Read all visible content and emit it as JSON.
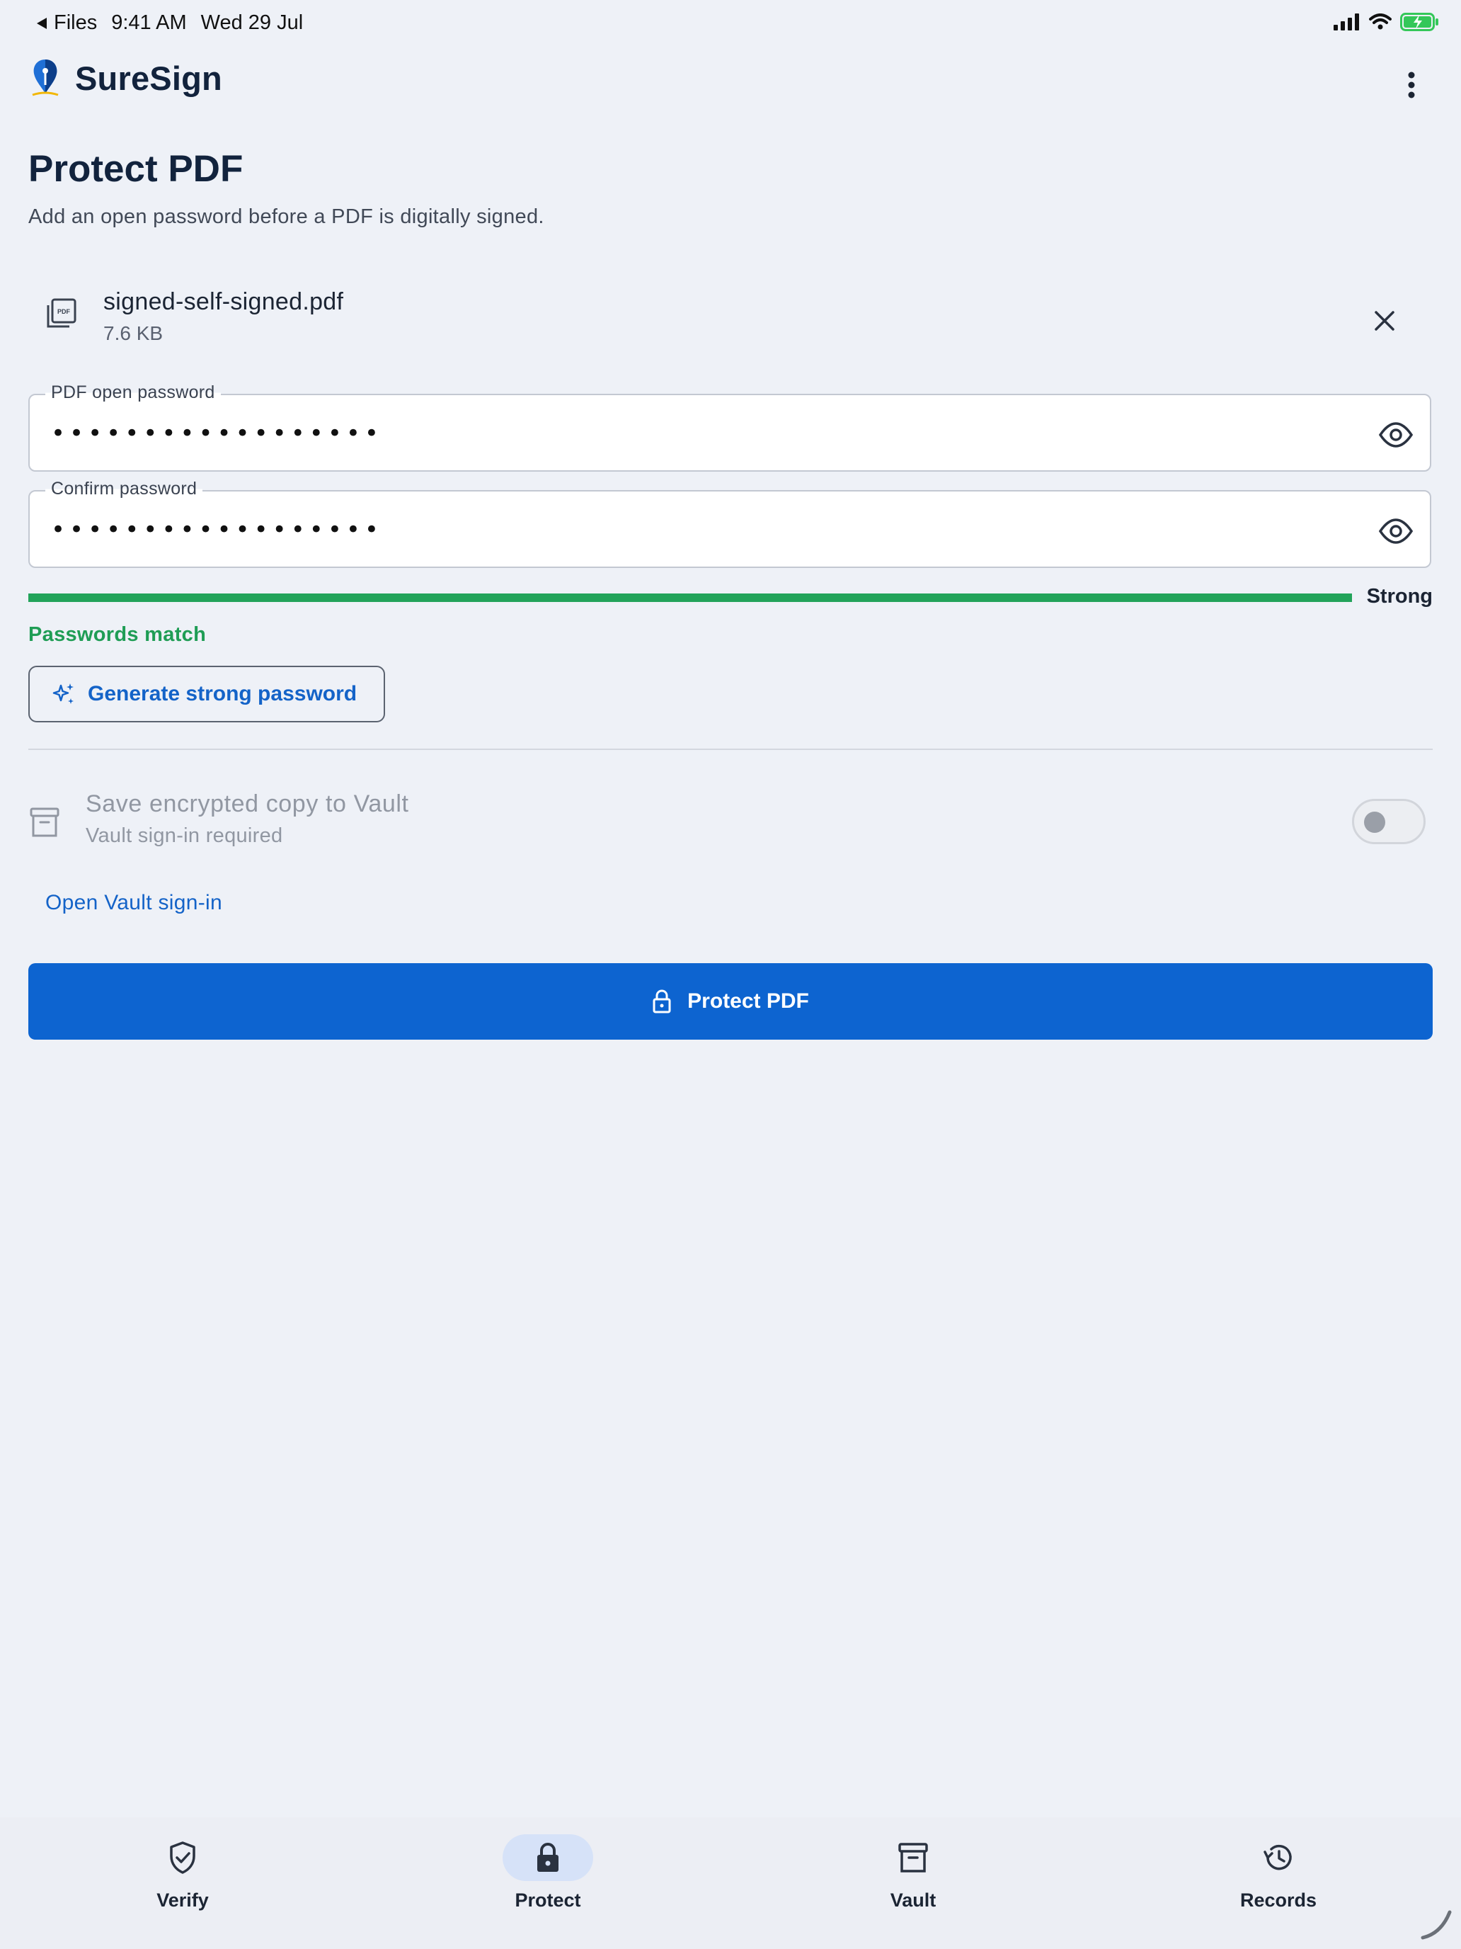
{
  "status_bar": {
    "back_label": "Files",
    "time": "9:41 AM",
    "date": "Wed 29 Jul"
  },
  "app": {
    "name": "SureSign"
  },
  "page": {
    "title": "Protect PDF",
    "subtitle": "Add an open password before a PDF is digitally signed."
  },
  "file": {
    "name": "signed-self-signed.pdf",
    "size": "7.6 KB"
  },
  "fields": {
    "password": {
      "label": "PDF open password",
      "value": "••••••••••••••••••"
    },
    "confirm": {
      "label": "Confirm password",
      "value": "••••••••••••••••••"
    }
  },
  "strength": {
    "label": "Strong",
    "level": 1.0,
    "match_text": "Passwords match"
  },
  "generate_button": "Generate strong password",
  "vault": {
    "title": "Save encrypted copy to Vault",
    "subtitle": "Vault sign-in required",
    "toggle_on": false,
    "link": "Open Vault sign-in"
  },
  "primary_button": "Protect PDF",
  "nav": {
    "items": [
      {
        "label": "Verify",
        "icon": "shield-check-icon"
      },
      {
        "label": "Protect",
        "icon": "lock-icon",
        "active": true
      },
      {
        "label": "Vault",
        "icon": "archive-icon"
      },
      {
        "label": "Records",
        "icon": "history-icon"
      }
    ]
  },
  "colors": {
    "accent": "#0d64d0",
    "success": "#22a35a",
    "background": "#eef1f7"
  }
}
